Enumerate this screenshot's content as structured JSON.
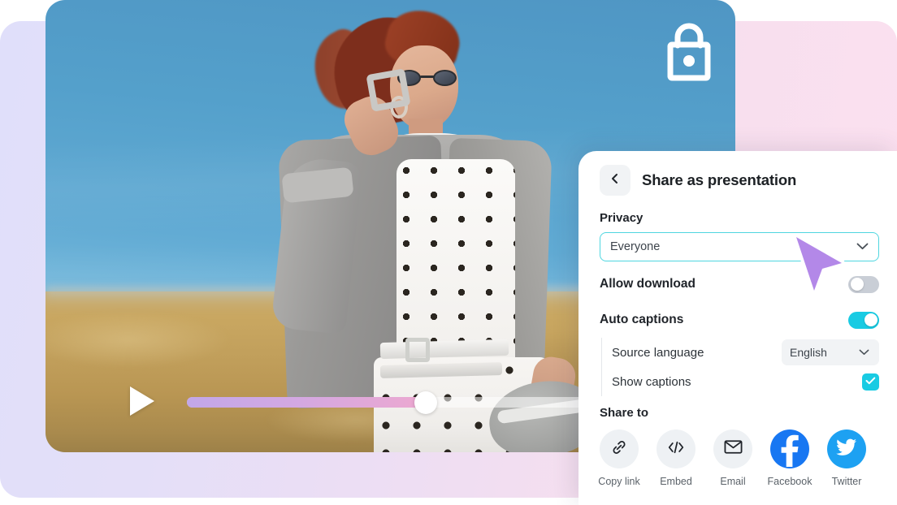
{
  "media": {
    "lock_icon": "lock-icon",
    "play_icon": "play-icon",
    "progress_percent": 42
  },
  "panel": {
    "back_icon": "chevron-left-icon",
    "title": "Share as presentation",
    "privacy": {
      "label": "Privacy",
      "selected": "Everyone",
      "chevron_icon": "chevron-down-icon"
    },
    "allow_download": {
      "label": "Allow download",
      "state": "off"
    },
    "auto_captions": {
      "label": "Auto captions",
      "state": "on"
    },
    "source_language": {
      "label": "Source language",
      "selected": "English",
      "chevron_icon": "chevron-down-icon"
    },
    "show_captions": {
      "label": "Show captions",
      "checked": true,
      "check_icon": "check-icon"
    },
    "share_to": {
      "label": "Share to",
      "items": [
        {
          "label": "Copy link",
          "icon": "link-icon"
        },
        {
          "label": "Embed",
          "icon": "code-icon"
        },
        {
          "label": "Email",
          "icon": "envelope-icon"
        },
        {
          "label": "Facebook",
          "icon": "facebook-icon"
        },
        {
          "label": "Twitter",
          "icon": "twitter-icon"
        }
      ]
    }
  },
  "cursor": {
    "icon": "cursor-arrow-icon"
  },
  "colors": {
    "accent_cyan": "#19cbe3",
    "facebook_blue": "#1877f2",
    "twitter_blue": "#1da1f2",
    "cursor_purple": "#b388e8"
  }
}
